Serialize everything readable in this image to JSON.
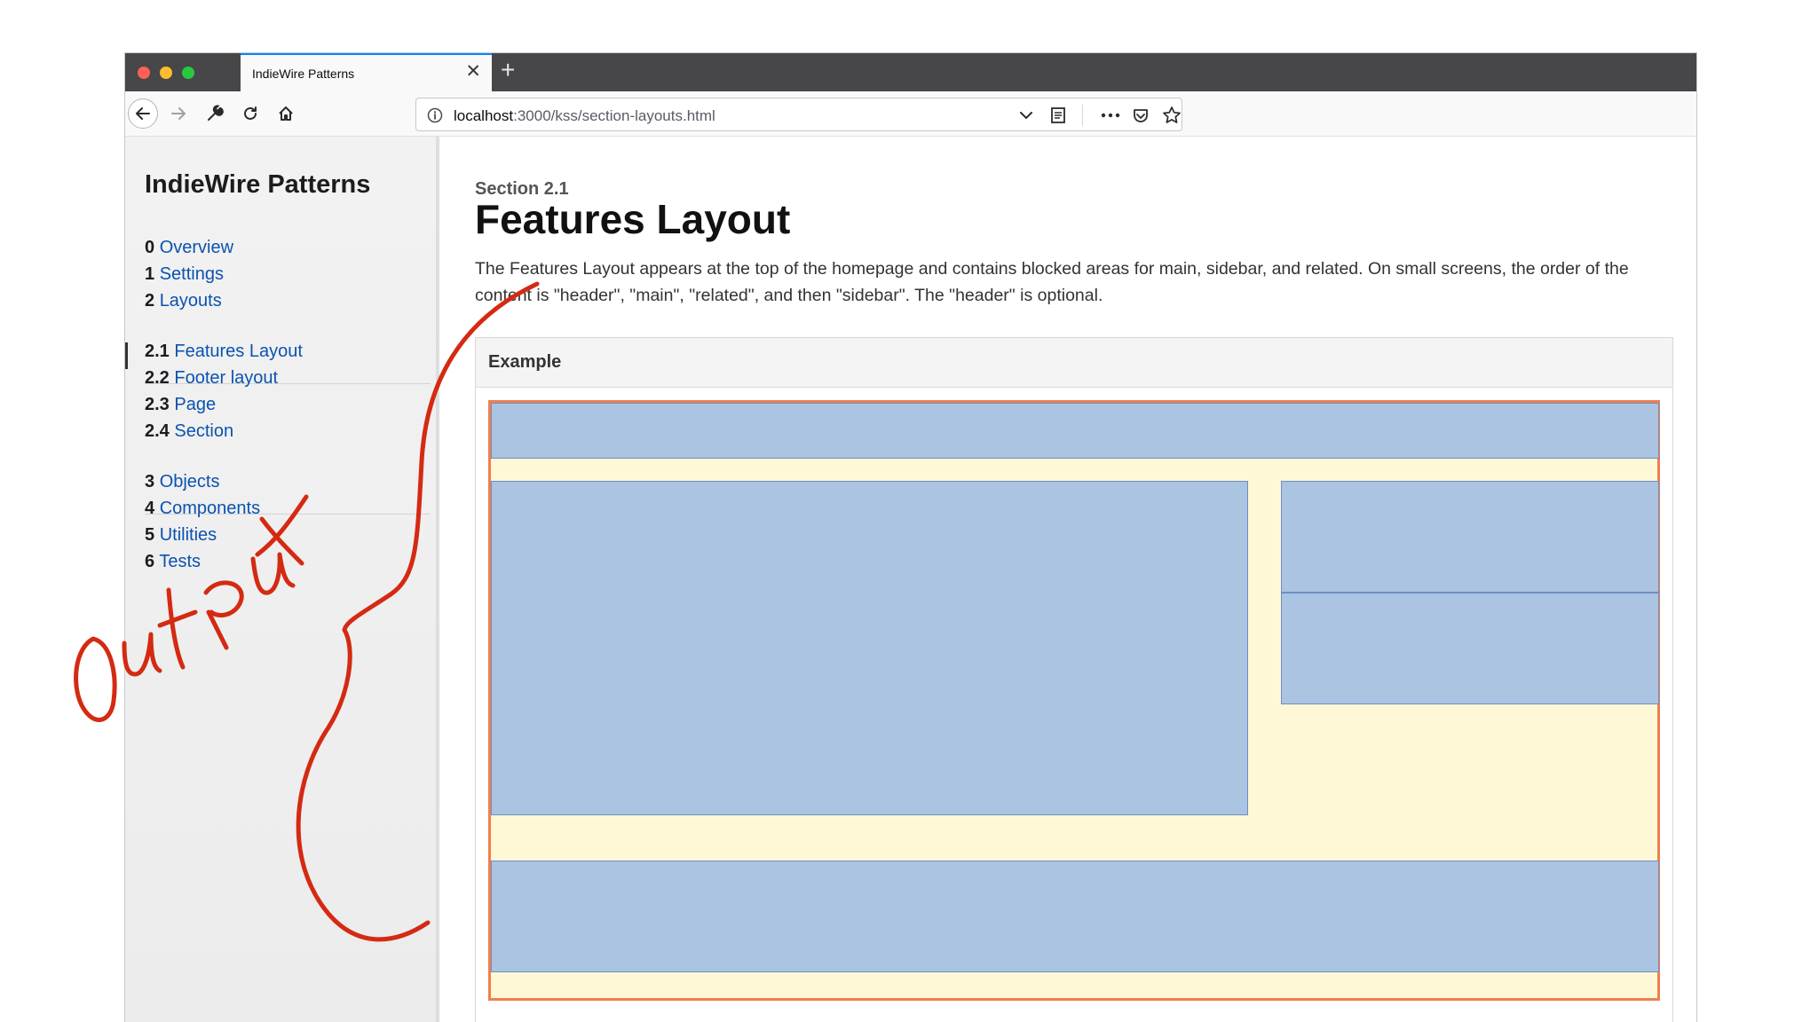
{
  "browser": {
    "tab_title": "IndieWire Patterns",
    "tab_close": "✕",
    "new_tab": "+",
    "url_host": "localhost",
    "url_path": ":3000/kss/section-layouts.html"
  },
  "sidebar": {
    "brand": "IndieWire Patterns",
    "group1": [
      {
        "num": "0",
        "label": "Overview"
      },
      {
        "num": "1",
        "label": "Settings"
      },
      {
        "num": "2",
        "label": "Layouts"
      }
    ],
    "group2": [
      {
        "num": "2.1",
        "label": "Features Layout"
      },
      {
        "num": "2.2",
        "label": "Footer layout"
      },
      {
        "num": "2.3",
        "label": "Page"
      },
      {
        "num": "2.4",
        "label": "Section"
      }
    ],
    "group3": [
      {
        "num": "3",
        "label": "Objects"
      },
      {
        "num": "4",
        "label": "Components"
      },
      {
        "num": "5",
        "label": "Utilities"
      },
      {
        "num": "6",
        "label": "Tests"
      }
    ]
  },
  "main": {
    "section_label": "Section 2.1",
    "title": "Features Layout",
    "description": "The Features Layout appears at the top of the homepage and contains blocked areas for main, sidebar, and related. On small screens, the order of the content is \"header\", \"main\", \"related\", and then \"sidebar\". The \"header\" is optional.",
    "example_label": "Example"
  },
  "annotation": {
    "text": "Output",
    "color": "#d42a12"
  },
  "colors": {
    "block_fill": "#aac4e2",
    "block_border": "#6d8fc2",
    "demo_bg": "#fff8d7",
    "demo_border": "#f07f4c",
    "link": "#0b52b0"
  }
}
